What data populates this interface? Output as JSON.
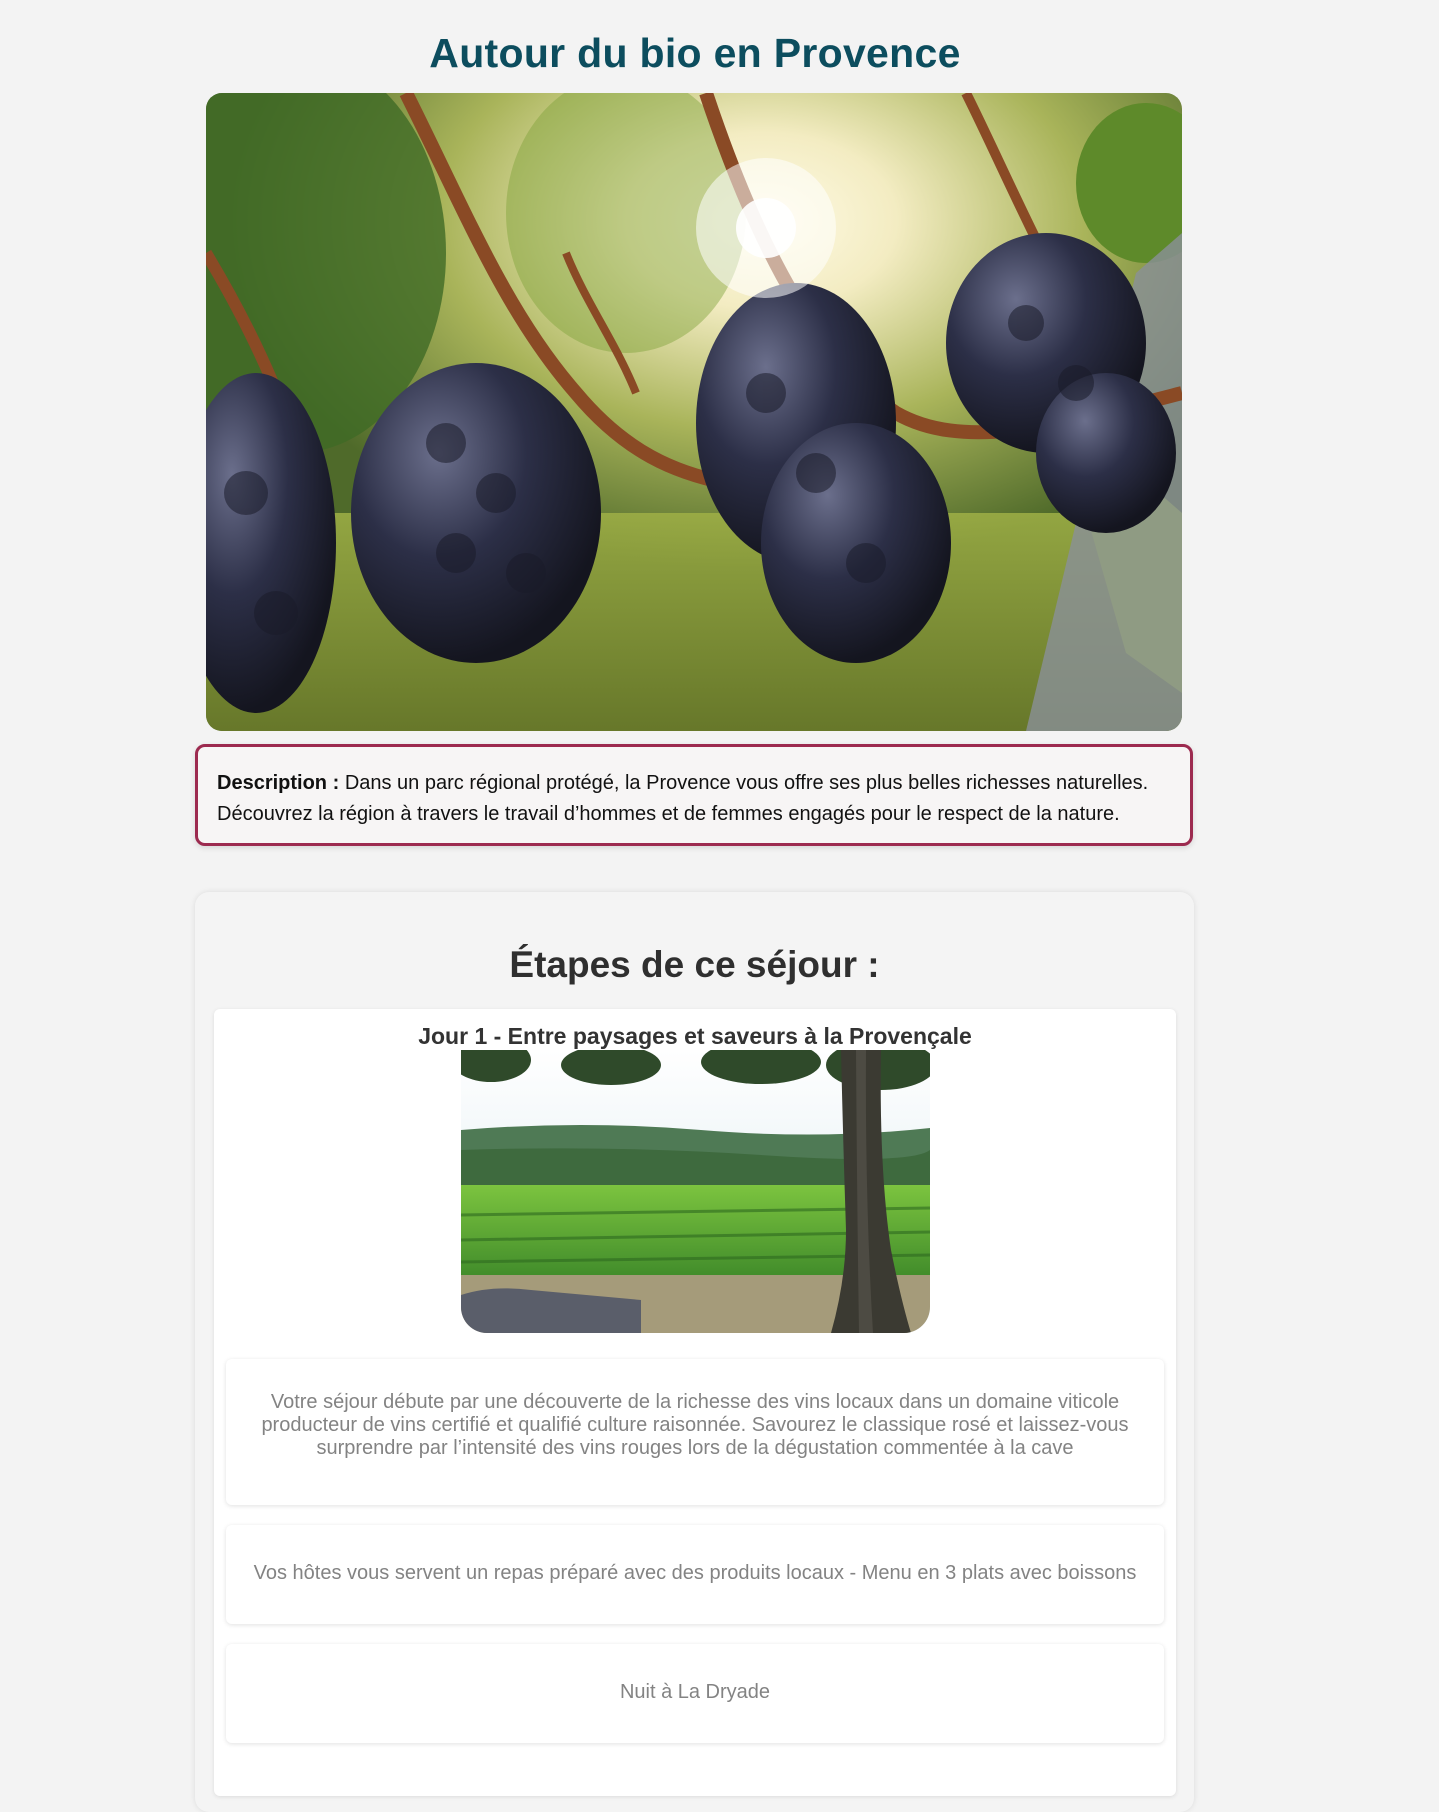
{
  "page": {
    "title": "Autour du bio en Provence",
    "hero_image_alt": "Grappes de raisin noir dans une vigne au soleil"
  },
  "description": {
    "label": "Description :",
    "text": "Dans un parc régional protégé, la Provence vous offre ses plus belles richesses naturelles. Découvrez la région à travers le travail d’hommes et de femmes engagés pour le respect de la nature."
  },
  "steps": {
    "title": "Étapes de ce séjour :",
    "days": [
      {
        "title": "Jour 1 - Entre paysages et saveurs à la Provençale",
        "image_alt": "Vignoble provençal sous un arbre",
        "activities": [
          "Votre séjour débute par une découverte de la richesse des vins locaux dans un domaine viticole producteur de vins certifié et qualifié culture raisonnée. Savourez le classique rosé et laissez-vous surprendre par l’intensité des vins rouges lors de la dégustation commentée à la cave",
          "Vos hôtes vous servent un repas préparé avec des produits locaux - Menu en 3 plats avec boissons",
          "Nuit à La Dryade"
        ]
      }
    ]
  },
  "colors": {
    "title": "#0c4d5e",
    "description_border": "#9c2a4f",
    "activity_text": "#838383",
    "background": "#f3f3f3"
  }
}
